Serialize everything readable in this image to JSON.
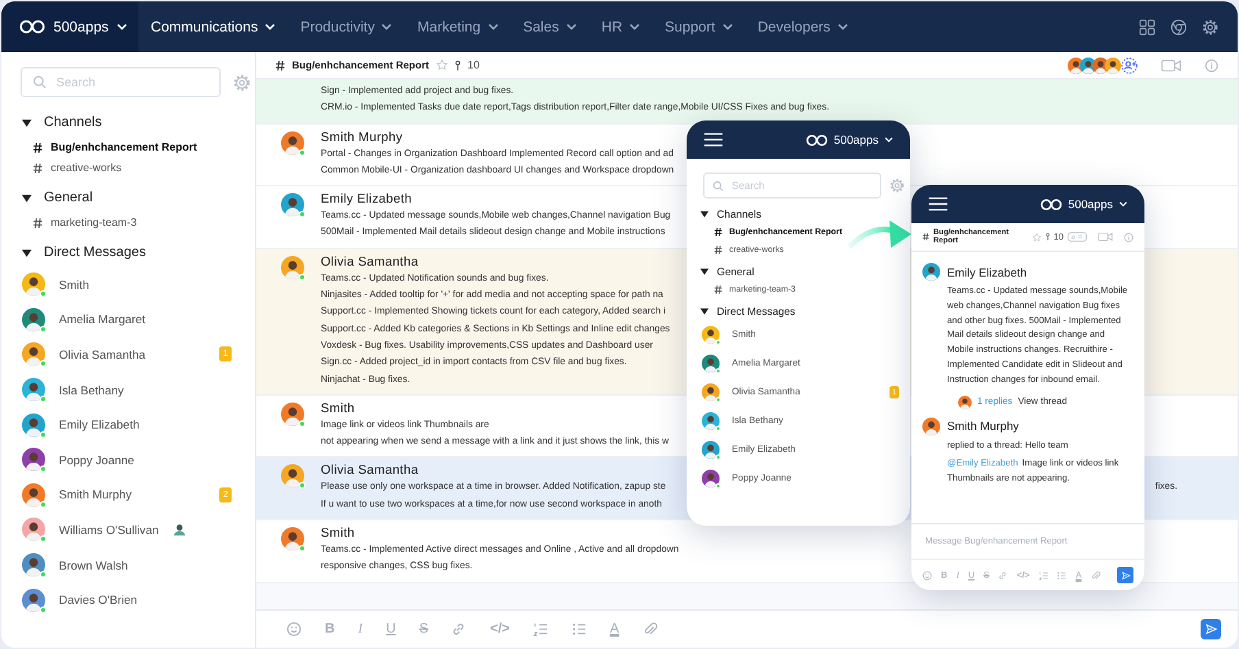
{
  "topbar": {
    "brand": "500apps",
    "menus": [
      {
        "label": "Communications",
        "selected": true
      },
      {
        "label": "Productivity",
        "selected": false
      },
      {
        "label": "Marketing",
        "selected": false
      },
      {
        "label": "Sales",
        "selected": false
      },
      {
        "label": "HR",
        "selected": false
      },
      {
        "label": "Support",
        "selected": false
      },
      {
        "label": "Developers",
        "selected": false
      }
    ]
  },
  "sidebar": {
    "search": {
      "placeholder": "Search"
    },
    "sections": [
      {
        "title": "Channels",
        "expanded": true,
        "items": [
          {
            "kind": "channel",
            "name": "Bug/enhchancement Report",
            "selected": true
          },
          {
            "kind": "channel",
            "name": "creative-works",
            "selected": false
          }
        ]
      },
      {
        "title": "General",
        "expanded": true,
        "items": [
          {
            "kind": "channel",
            "name": "marketing-team-3",
            "selected": false
          }
        ]
      },
      {
        "title": "Direct Messages",
        "expanded": true,
        "items": [
          {
            "kind": "person",
            "name": "Smith",
            "color": "#f5b915",
            "online": true
          },
          {
            "kind": "person",
            "name": "Amelia Margaret",
            "color": "#1f8a7a",
            "online": true
          },
          {
            "kind": "person",
            "name": "Olivia Samantha",
            "color": "#f5a623",
            "online": true,
            "badge": "1"
          },
          {
            "kind": "person",
            "name": "Isla Bethany",
            "color": "#2bb3d9",
            "online": true
          },
          {
            "kind": "person",
            "name": "Emily Elizabeth",
            "color": "#22a4cc",
            "online": true
          },
          {
            "kind": "person",
            "name": "Poppy Joanne",
            "color": "#8e3fa8",
            "online": true
          },
          {
            "kind": "person",
            "name": "Smith Murphy",
            "color": "#f07a2a",
            "online": true,
            "badge": "2"
          },
          {
            "kind": "person",
            "name": "Williams O'Sullivan",
            "color": "#f4a6a6",
            "online": true,
            "status_icon": true
          },
          {
            "kind": "person",
            "name": "Brown Walsh",
            "color": "#4f8fc0",
            "online": true
          },
          {
            "kind": "person",
            "name": "Davies O'Brien",
            "color": "#5b8fd0",
            "online": true
          }
        ]
      }
    ]
  },
  "channel_header": {
    "title": "Bug/enhchancement Report",
    "starred": false,
    "pin_count": "10",
    "members": [
      {
        "color": "#f07a2a"
      },
      {
        "color": "#22a4cc"
      },
      {
        "color": "#e06a1f"
      },
      {
        "color": "#f5a623"
      }
    ]
  },
  "messages": [
    {
      "color": "#e9f8ee",
      "lines": [
        {
          "text": "Sign - Implemented add project and bug fixes."
        },
        {
          "text": "CRM.io - Implemented Tasks due date report,Tags distribution report,Filter date range,Mobile UI/CSS Fixes and bug fixes."
        }
      ]
    },
    {
      "color": "#ffffff",
      "author": "Smith Murphy",
      "avatar": {
        "color": "#f07a2a",
        "online": true
      },
      "lines": [
        {
          "text": "Portal - Changes in Organization Dashboard Implemented Record call option and ad"
        },
        {
          "text": "Common Mobile-UI - Organization dashboard UI changes and Workspace dropdown"
        }
      ]
    },
    {
      "color": "#ffffff",
      "author": "Emily Elizabeth",
      "avatar": {
        "color": "#22a4cc",
        "online": true
      },
      "lines": [
        {
          "text": "Teams.cc - Updated message sounds,Mobile web changes,Channel navigation Bug"
        },
        {
          "text": "500Mail - Implemented Mail details slideout design change and Mobile instructions"
        }
      ]
    },
    {
      "color": "#fbf6ea",
      "author": "Olivia Samantha",
      "avatar": {
        "color": "#f5a623",
        "online": true
      },
      "lines": [
        {
          "text": "Teams.cc - Updated Notification sounds and bug fixes."
        },
        {
          "text": "Ninjasites - Added tooltip for '+' for add media and not accepting space for path na"
        },
        {
          "text": "Support.cc - Implemented Showing tickets count for each category, Added search i"
        },
        {
          "text": "Support.cc - Added Kb categories & Sections in Kb Settings and Inline edit changes"
        },
        {
          "text": "Voxdesk - Bug fixes. Usability improvements,CSS updates and Dashboard user"
        },
        {
          "text": "Sign.cc - Added project_id in import contacts from CSV file and bug fixes."
        },
        {
          "text": "Ninjachat - Bug fixes."
        }
      ]
    },
    {
      "color": "#ffffff",
      "author": "Smith",
      "avatar": {
        "color": "#f07a2a",
        "online": true
      },
      "lines": [
        {
          "text": "Image link or videos link Thumbnails are"
        },
        {
          "text": "not appearing when we send a message with a link and it just shows the link, this w"
        }
      ]
    },
    {
      "color": "#e6eefa",
      "author": "Olivia Samantha",
      "avatar": {
        "color": "#f5a623",
        "online": true
      },
      "lines": [
        {
          "text": "Please use only one workspace at a time in browser. Added Notification, zapup ste",
          "tail": "fixes."
        },
        {
          "text": "If u want to use two workspaces at a time,for now use second workspace in anoth"
        }
      ]
    },
    {
      "color": "#ffffff",
      "author": "Smith",
      "avatar": {
        "color": "#f07a2a",
        "online": true
      },
      "lines": [
        {
          "text": "Teams.cc - Implemented Active direct messages and Online , Active and all dropdown"
        },
        {
          "text": "responsive changes, CSS bug fixes."
        }
      ]
    }
  ],
  "composer": {
    "tools": [
      {
        "kind": "emoji"
      },
      {
        "kind": "bold",
        "glyph": "B"
      },
      {
        "kind": "italic",
        "glyph": "I"
      },
      {
        "kind": "underline",
        "glyph": "U"
      },
      {
        "kind": "strike",
        "glyph": "S"
      },
      {
        "kind": "link"
      },
      {
        "kind": "code",
        "glyph": "</>"
      },
      {
        "kind": "numbered-list"
      },
      {
        "kind": "bullet-list"
      },
      {
        "kind": "text-color",
        "glyph": "A"
      },
      {
        "kind": "attachment"
      }
    ]
  },
  "phone_sidebar": {
    "brand": "500apps",
    "search": {
      "placeholder": "Search"
    },
    "sections": [
      {
        "title": "Channels",
        "expanded": true,
        "items": [
          {
            "kind": "channel",
            "name": "Bug/enhchancement Report",
            "selected": true
          },
          {
            "kind": "channel",
            "name": "creative-works",
            "selected": false
          }
        ]
      },
      {
        "title": "General",
        "expanded": true,
        "items": [
          {
            "kind": "channel",
            "name": "marketing-team-3",
            "selected": false
          }
        ]
      },
      {
        "title": "Direct Messages",
        "expanded": true,
        "items": [
          {
            "kind": "person",
            "name": "Smith",
            "color": "#f5b915",
            "online": true
          },
          {
            "kind": "person",
            "name": "Amelia Margaret",
            "color": "#1f8a7a",
            "online": true
          },
          {
            "kind": "person",
            "name": "Olivia Samantha",
            "color": "#f5a623",
            "online": true,
            "badge": "1"
          },
          {
            "kind": "person",
            "name": "Isla Bethany",
            "color": "#2bb3d9",
            "online": true
          },
          {
            "kind": "person",
            "name": "Emily Elizabeth",
            "color": "#22a4cc",
            "online": true
          },
          {
            "kind": "person",
            "name": "Poppy Joanne",
            "color": "#8e3fa8",
            "online": true
          }
        ]
      }
    ]
  },
  "phone_thread": {
    "brand": "500apps",
    "channel": {
      "title": "Bug/enhchancement Report",
      "starred": false,
      "pin_count": "10"
    },
    "messages": [
      {
        "author": "Emily Elizabeth",
        "avatar": {
          "color": "#22a4cc"
        },
        "paragraphs": [
          {
            "text": "Teams.cc - Updated message sounds,Mobile web changes,Channel navigation Bug fixes and other bug fixes. 500Mail - Implemented Mail details slideout design change and Mobile instructions changes. Recruithire - Implemented Candidate edit in Slideout and Instruction changes for inbound email."
          }
        ],
        "replies": {
          "avatar": {
            "color": "#f07a2a"
          },
          "count": "1 replies",
          "link": "View thread"
        }
      },
      {
        "author": "Smith Murphy",
        "avatar": {
          "color": "#f07a2a"
        },
        "paragraphs": [
          {
            "text": "replied to a thread: Hello team"
          },
          {
            "mention": "@Emily Elizabeth",
            "text": "Image link or videos link Thumbnails are not appearing."
          }
        ]
      }
    ],
    "composer": {
      "placeholder": "Message Bug/enhancement Report",
      "tools": [
        {
          "kind": "emoji"
        },
        {
          "kind": "bold",
          "glyph": "B"
        },
        {
          "kind": "italic",
          "glyph": "I"
        },
        {
          "kind": "underline",
          "glyph": "U"
        },
        {
          "kind": "strike",
          "glyph": "S"
        },
        {
          "kind": "link"
        },
        {
          "kind": "code",
          "glyph": "</>"
        },
        {
          "kind": "numbered-list"
        },
        {
          "kind": "bullet-list"
        },
        {
          "kind": "text-color",
          "glyph": "A"
        },
        {
          "kind": "attachment"
        }
      ]
    }
  }
}
